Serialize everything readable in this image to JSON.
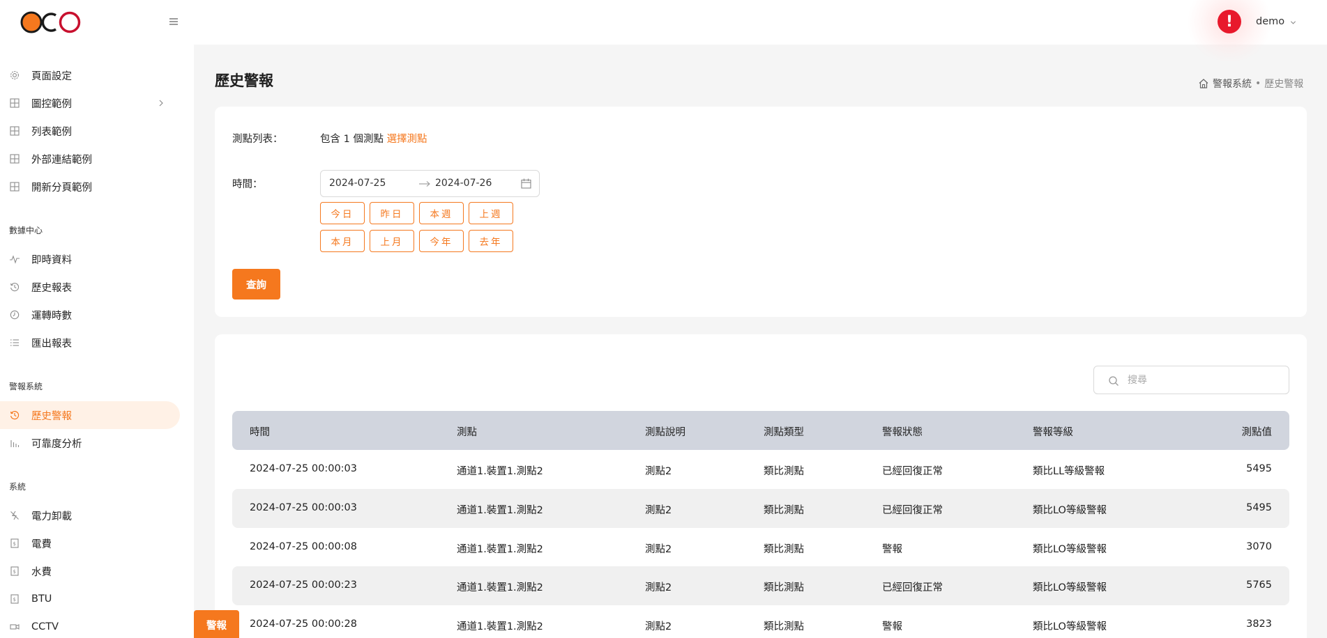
{
  "brand": {
    "logo_text": "OCO",
    "colors": {
      "accent": "#f5781e",
      "logo_orange": "#f5781e",
      "logo_red": "#c8102e",
      "alert_red": "#e8192c"
    }
  },
  "sidebar": {
    "items_top": [
      {
        "label": "頁面設定",
        "icon": "gear-icon"
      },
      {
        "label": "圖控範例",
        "icon": "grid-icon",
        "has_children": true
      },
      {
        "label": "列表範例",
        "icon": "grid-icon"
      },
      {
        "label": "外部連結範例",
        "icon": "grid-icon"
      },
      {
        "label": "開新分頁範例",
        "icon": "grid-icon"
      }
    ],
    "groups": [
      {
        "title": "數據中心",
        "items": [
          {
            "label": "即時資料",
            "icon": "pulse-icon"
          },
          {
            "label": "歷史報表",
            "icon": "history-icon"
          },
          {
            "label": "運轉時數",
            "icon": "clock-icon"
          },
          {
            "label": "匯出報表",
            "icon": "list-icon"
          }
        ]
      },
      {
        "title": "警報系統",
        "items": [
          {
            "label": "歷史警報",
            "icon": "history-icon",
            "active": true
          },
          {
            "label": "可靠度分析",
            "icon": "bar-chart-icon"
          }
        ]
      },
      {
        "title": "系統",
        "items": [
          {
            "label": "電力卸載",
            "icon": "power-off-icon"
          },
          {
            "label": "電費",
            "icon": "bill-icon"
          },
          {
            "label": "水費",
            "icon": "bill-icon"
          },
          {
            "label": "BTU",
            "icon": "bill-icon"
          },
          {
            "label": "CCTV",
            "icon": "camera-icon"
          }
        ]
      }
    ]
  },
  "header": {
    "user_name": "demo",
    "alert_symbol": "!"
  },
  "page": {
    "title": "歷史警報",
    "breadcrumb": {
      "parent": "警報系統",
      "separator": "•",
      "current": "歷史警報"
    }
  },
  "filter": {
    "points_label": "測點列表：",
    "points_summary": "包含 1 個測點",
    "select_points_link": "選擇測點",
    "time_label": "時間：",
    "date_start": "2024-07-25",
    "date_end": "2024-07-26",
    "presets_row1": [
      "今日",
      "昨日",
      "本週",
      "上週"
    ],
    "presets_row2": [
      "本月",
      "上月",
      "今年",
      "去年"
    ],
    "query_button": "查詢"
  },
  "search": {
    "placeholder": "搜尋",
    "value": ""
  },
  "table": {
    "headers": {
      "time": "時間",
      "point": "測點",
      "description": "測點說明",
      "type": "測點類型",
      "status": "警報狀態",
      "level": "警報等級",
      "value": "測點值"
    },
    "rows": [
      {
        "time": "2024-07-25 00:00:03",
        "point": "通道1.裝置1.測點2",
        "description": "測點2",
        "type": "類比測點",
        "status": "已經回復正常",
        "level": "類比LL等級警報",
        "value": "5495"
      },
      {
        "time": "2024-07-25 00:00:03",
        "point": "通道1.裝置1.測點2",
        "description": "測點2",
        "type": "類比測點",
        "status": "已經回復正常",
        "level": "類比LO等級警報",
        "value": "5495"
      },
      {
        "time": "2024-07-25 00:00:08",
        "point": "通道1.裝置1.測點2",
        "description": "測點2",
        "type": "類比測點",
        "status": "警報",
        "level": "類比LO等級警報",
        "value": "3070"
      },
      {
        "time": "2024-07-25 00:00:23",
        "point": "通道1.裝置1.測點2",
        "description": "測點2",
        "type": "類比測點",
        "status": "已經回復正常",
        "level": "類比LO等級警報",
        "value": "5765"
      },
      {
        "time": "2024-07-25 00:00:28",
        "point": "通道1.裝置1.測點2",
        "description": "測點2",
        "type": "類比測點",
        "status": "警報",
        "level": "類比LO等級警報",
        "value": "3823"
      }
    ]
  },
  "floating_tab": {
    "label": "警報"
  }
}
